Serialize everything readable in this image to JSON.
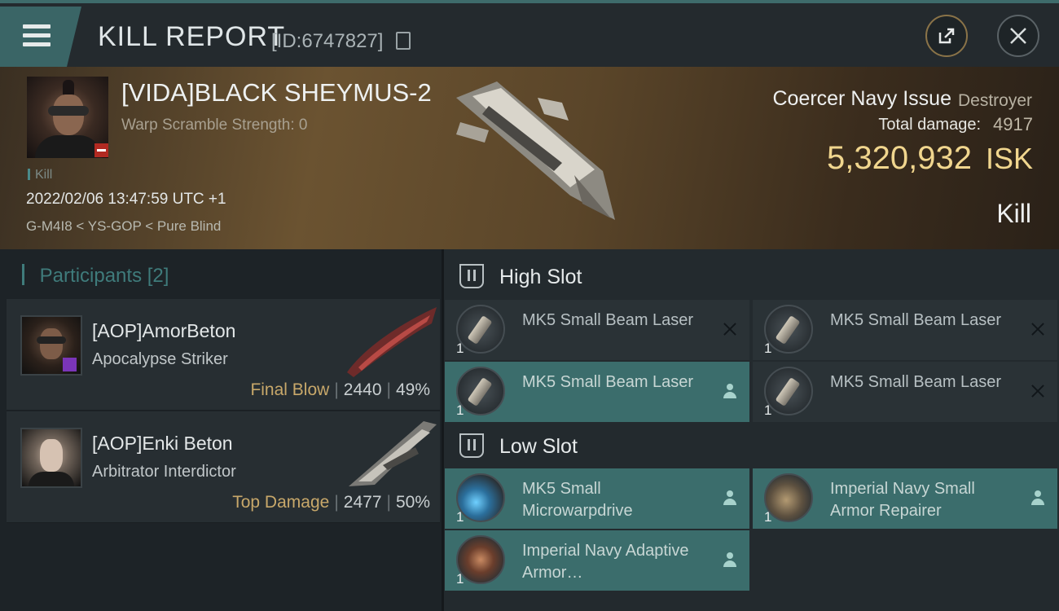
{
  "title_bar": {
    "menu_label": "",
    "title": "KILL REPORT",
    "kill_id": "[ID:6747827]"
  },
  "victim": {
    "name": "[VIDA]BLACK SHEYMUS-2",
    "warp_scramble": "Warp Scramble Strength: 0",
    "kill_tag": "Kill",
    "datetime": "2022/02/06 13:47:59 UTC +1",
    "location": "G-M4I8 < YS-GOP < Pure Blind",
    "ship_name": "Coercer Navy Issue",
    "ship_class": "Destroyer",
    "total_damage_label": "Total damage:",
    "total_damage_value": "4917",
    "isk_value": "5,320,932",
    "isk_unit": "ISK",
    "kill_type": "Kill"
  },
  "participants": {
    "header": "Participants",
    "count": "[2]",
    "items": [
      {
        "name": "[AOP]AmorBeton",
        "ship": "Apocalypse Striker",
        "role": "Final Blow",
        "damage": "2440",
        "percent": "49%"
      },
      {
        "name": "[AOP]Enki Beton",
        "ship": "Arbitrator Interdictor",
        "role": "Top Damage",
        "damage": "2477",
        "percent": "50%"
      }
    ]
  },
  "fitting": {
    "high_slot_label": "High Slot",
    "low_slot_label": "Low Slot",
    "high_slot": [
      {
        "name": "MK5 Small Beam Laser",
        "qty": "1",
        "status": "destroyed"
      },
      {
        "name": "MK5 Small Beam Laser",
        "qty": "1",
        "status": "destroyed"
      },
      {
        "name": "MK5 Small Beam Laser",
        "qty": "1",
        "status": "dropped"
      },
      {
        "name": "MK5 Small Beam Laser",
        "qty": "1",
        "status": "destroyed"
      }
    ],
    "low_slot": [
      {
        "name": "MK5 Small Microwarpdrive",
        "qty": "1",
        "status": "dropped"
      },
      {
        "name": "Imperial Navy Small Armor Repairer",
        "qty": "1",
        "status": "dropped"
      },
      {
        "name": "Imperial Navy Adaptive Armor…",
        "qty": "1",
        "status": "dropped"
      }
    ]
  },
  "colors": {
    "accent_teal": "#3b6d6c",
    "isk_gold": "#f1d68e",
    "role_gold": "#c8a86a",
    "loss_red": "#b12a22"
  },
  "icons": [
    "menu-icon",
    "copy-icon",
    "share-icon",
    "close-icon",
    "slot-icon",
    "destroyed-icon",
    "pilot-icon"
  ]
}
